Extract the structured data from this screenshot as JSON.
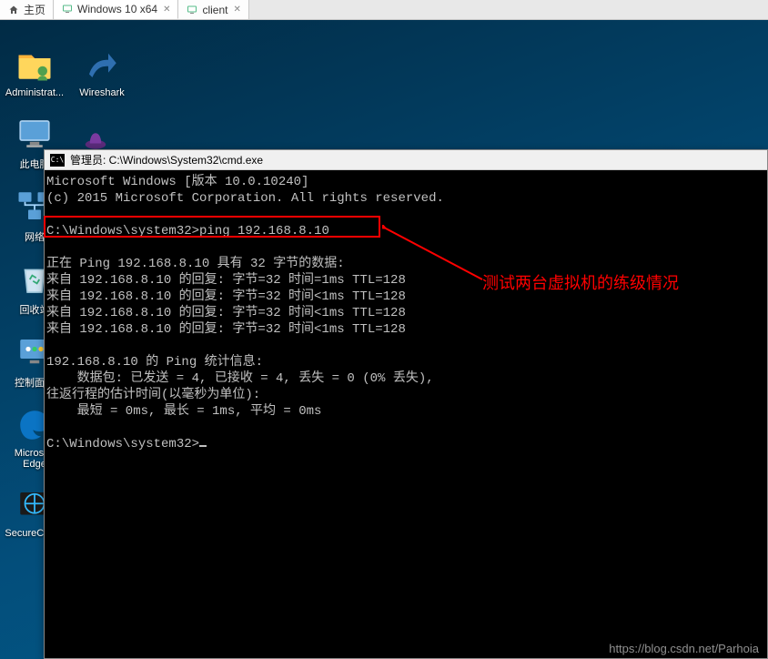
{
  "tabs": [
    {
      "label": "主页",
      "icon": "home"
    },
    {
      "label": "Windows 10 x64",
      "icon": "vm",
      "closable": true
    },
    {
      "label": "client",
      "icon": "vm",
      "closable": true
    }
  ],
  "desktop_icons": {
    "admin": {
      "label": "Administrat..."
    },
    "wireshark": {
      "label": "Wireshark"
    },
    "pc": {
      "label": "此电脑"
    },
    "net": {
      "label": "网络"
    },
    "recycle": {
      "label": "回收站"
    },
    "ctrl": {
      "label": "控制面板"
    },
    "edge": {
      "label": "Microsoft Edge"
    },
    "secure": {
      "label": "SecureCRT..."
    }
  },
  "cmd": {
    "title": "管理员: C:\\Windows\\System32\\cmd.exe",
    "lines": [
      "Microsoft Windows [版本 10.0.10240]",
      "(c) 2015 Microsoft Corporation. All rights reserved.",
      "",
      "C:\\Windows\\system32>ping 192.168.8.10",
      "",
      "正在 Ping 192.168.8.10 具有 32 字节的数据:",
      "来自 192.168.8.10 的回复: 字节=32 时间=1ms TTL=128",
      "来自 192.168.8.10 的回复: 字节=32 时间<1ms TTL=128",
      "来自 192.168.8.10 的回复: 字节=32 时间<1ms TTL=128",
      "来自 192.168.8.10 的回复: 字节=32 时间<1ms TTL=128",
      "",
      "192.168.8.10 的 Ping 统计信息:",
      "    数据包: 已发送 = 4, 已接收 = 4, 丢失 = 0 (0% 丢失),",
      "往返行程的估计时间(以毫秒为单位):",
      "    最短 = 0ms, 最长 = 1ms, 平均 = 0ms",
      "",
      "C:\\Windows\\system32>"
    ]
  },
  "annotation": {
    "text": "测试两台虚拟机的练级情况"
  },
  "watermark": "https://blog.csdn.net/Parhoia"
}
